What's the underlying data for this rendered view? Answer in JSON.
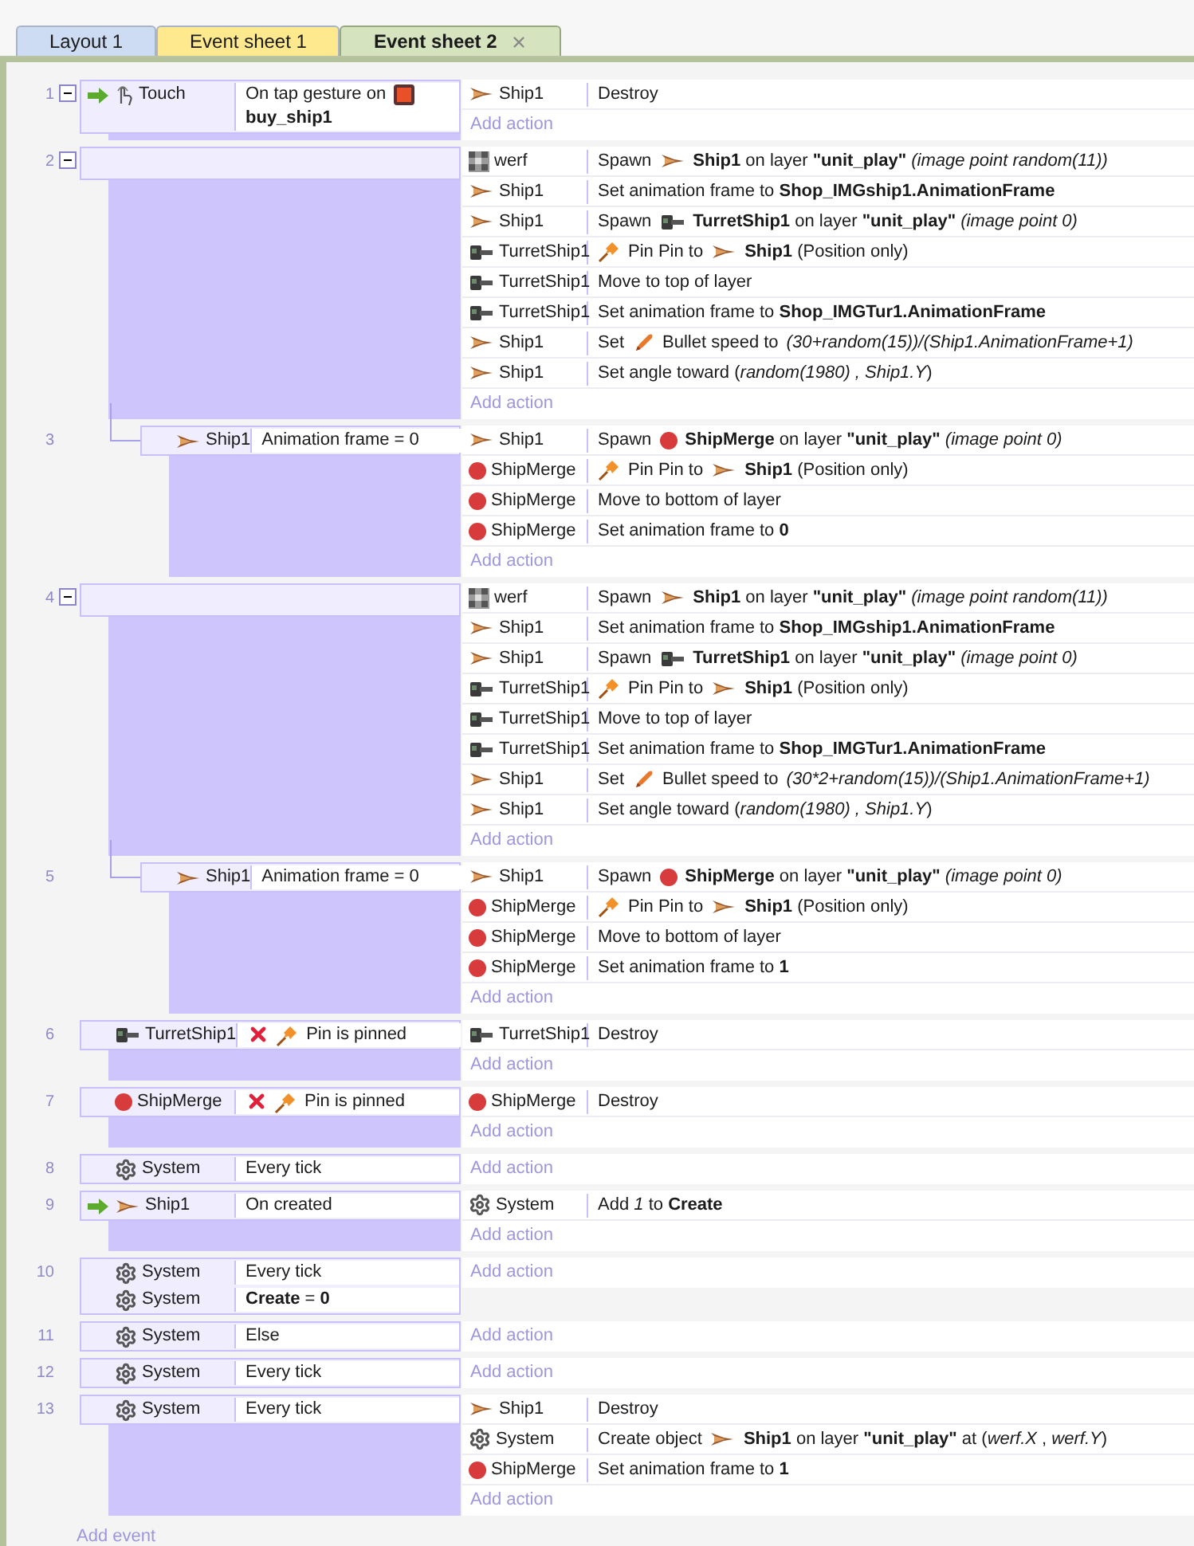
{
  "tabs": [
    {
      "label": "Layout 1",
      "selected": false,
      "color": "#cddcf2"
    },
    {
      "label": "Event sheet 1",
      "selected": false,
      "color": "#ffe98e"
    },
    {
      "label": "Event sheet 2",
      "selected": true,
      "color": "#d6e3bf"
    }
  ],
  "events": [
    {
      "number": "1",
      "expanded": true,
      "conditions": [
        {
          "trigger": true,
          "inverted": false,
          "object": {
            "kind": "touch",
            "name": "Touch"
          },
          "parts": [
            {
              "kind": "text",
              "text": "On tap gesture on"
            },
            {
              "kind": "button"
            },
            {
              "kind": "text",
              "text": "**buy_ship1**"
            }
          ]
        }
      ],
      "actions": [
        {
          "object": {
            "kind": "ship",
            "name": "Ship1"
          },
          "parts": [
            {
              "kind": "text",
              "text": "Destroy"
            }
          ]
        }
      ],
      "add_action": "Add action"
    },
    {
      "number": "2",
      "expanded": true,
      "actions": [
        {
          "object": {
            "kind": "tilemap",
            "name": "werf"
          },
          "parts": [
            {
              "kind": "text",
              "text": "Spawn"
            },
            {
              "kind": "ship"
            },
            {
              "kind": "text",
              "text": "**Ship1** on layer **\"unit_play\"** *(image point random(11))*"
            }
          ]
        },
        {
          "object": {
            "kind": "ship",
            "name": "Ship1"
          },
          "parts": [
            {
              "kind": "text",
              "text": "Set animation frame to **Shop_IMGship1.AnimationFrame**"
            }
          ]
        },
        {
          "object": {
            "kind": "ship",
            "name": "Ship1"
          },
          "parts": [
            {
              "kind": "text",
              "text": "Spawn"
            },
            {
              "kind": "turret"
            },
            {
              "kind": "text",
              "text": "**TurretShip1** on layer **\"unit_play\"** *(image point 0)*"
            }
          ]
        },
        {
          "object": {
            "kind": "turret",
            "name": "TurretShip1"
          },
          "parts": [
            {
              "kind": "pin"
            },
            {
              "kind": "text",
              "text": "Pin Pin to"
            },
            {
              "kind": "ship"
            },
            {
              "kind": "text",
              "text": "**Ship1** (Position only)"
            }
          ]
        },
        {
          "object": {
            "kind": "turret",
            "name": "TurretShip1"
          },
          "parts": [
            {
              "kind": "text",
              "text": "Move to top of layer"
            }
          ]
        },
        {
          "object": {
            "kind": "turret",
            "name": "TurretShip1"
          },
          "parts": [
            {
              "kind": "text",
              "text": "Set animation frame to **Shop_IMGTur1.AnimationFrame**"
            }
          ]
        },
        {
          "object": {
            "kind": "ship",
            "name": "Ship1"
          },
          "parts": [
            {
              "kind": "text",
              "text": "Set"
            },
            {
              "kind": "bullet"
            },
            {
              "kind": "text",
              "text": "Bullet speed to"
            },
            {
              "kind": "expr",
              "text": "(30+random(15))/(Ship1.AnimationFrame+1)"
            }
          ]
        },
        {
          "object": {
            "kind": "ship",
            "name": "Ship1"
          },
          "parts": [
            {
              "kind": "text",
              "text": "Set angle toward (*random(1980) , Ship1.Y*)"
            }
          ]
        }
      ],
      "add_action": "Add action",
      "children": [
        {
          "number": "3",
          "conditions": [
            {
              "trigger": false,
              "inverted": false,
              "object": {
                "kind": "ship",
                "name": "Ship1"
              },
              "parts": [
                {
                  "kind": "text",
                  "text": "Animation frame = 0"
                }
              ]
            }
          ],
          "actions": [
            {
              "object": {
                "kind": "ship",
                "name": "Ship1"
              },
              "parts": [
                {
                  "kind": "text",
                  "text": "Spawn"
                },
                {
                  "kind": "merge"
                },
                {
                  "kind": "text",
                  "text": "**ShipMerge** on layer **\"unit_play\"** *(image point 0)*"
                }
              ]
            },
            {
              "object": {
                "kind": "merge",
                "name": "ShipMerge"
              },
              "parts": [
                {
                  "kind": "pin"
                },
                {
                  "kind": "text",
                  "text": "Pin Pin to"
                },
                {
                  "kind": "ship"
                },
                {
                  "kind": "text",
                  "text": "**Ship1** (Position only)"
                }
              ]
            },
            {
              "object": {
                "kind": "merge",
                "name": "ShipMerge"
              },
              "parts": [
                {
                  "kind": "text",
                  "text": "Move to bottom of layer"
                }
              ]
            },
            {
              "object": {
                "kind": "merge",
                "name": "ShipMerge"
              },
              "parts": [
                {
                  "kind": "text",
                  "text": "Set animation frame to **0**"
                }
              ]
            }
          ],
          "add_action": "Add action"
        }
      ]
    },
    {
      "number": "4",
      "expanded": true,
      "actions": [
        {
          "object": {
            "kind": "tilemap",
            "name": "werf"
          },
          "parts": [
            {
              "kind": "text",
              "text": "Spawn"
            },
            {
              "kind": "ship"
            },
            {
              "kind": "text",
              "text": "**Ship1** on layer **\"unit_play\"** *(image point random(11))*"
            }
          ]
        },
        {
          "object": {
            "kind": "ship",
            "name": "Ship1"
          },
          "parts": [
            {
              "kind": "text",
              "text": "Set animation frame to **Shop_IMGship1.AnimationFrame**"
            }
          ]
        },
        {
          "object": {
            "kind": "ship",
            "name": "Ship1"
          },
          "parts": [
            {
              "kind": "text",
              "text": "Spawn"
            },
            {
              "kind": "turret"
            },
            {
              "kind": "text",
              "text": "**TurretShip1** on layer **\"unit_play\"** *(image point 0)*"
            }
          ]
        },
        {
          "object": {
            "kind": "turret",
            "name": "TurretShip1"
          },
          "parts": [
            {
              "kind": "pin"
            },
            {
              "kind": "text",
              "text": "Pin Pin to"
            },
            {
              "kind": "ship"
            },
            {
              "kind": "text",
              "text": "**Ship1** (Position only)"
            }
          ]
        },
        {
          "object": {
            "kind": "turret",
            "name": "TurretShip1"
          },
          "parts": [
            {
              "kind": "text",
              "text": "Move to top of layer"
            }
          ]
        },
        {
          "object": {
            "kind": "turret",
            "name": "TurretShip1"
          },
          "parts": [
            {
              "kind": "text",
              "text": "Set animation frame to **Shop_IMGTur1.AnimationFrame**"
            }
          ]
        },
        {
          "object": {
            "kind": "ship",
            "name": "Ship1"
          },
          "parts": [
            {
              "kind": "text",
              "text": "Set"
            },
            {
              "kind": "bullet"
            },
            {
              "kind": "text",
              "text": "Bullet speed to"
            },
            {
              "kind": "expr",
              "text": "(30*2+random(15))/(Ship1.AnimationFrame+1)"
            }
          ]
        },
        {
          "object": {
            "kind": "ship",
            "name": "Ship1"
          },
          "parts": [
            {
              "kind": "text",
              "text": "Set angle toward (*random(1980) , Ship1.Y*)"
            }
          ]
        }
      ],
      "add_action": "Add action",
      "children": [
        {
          "number": "5",
          "conditions": [
            {
              "trigger": false,
              "inverted": false,
              "object": {
                "kind": "ship",
                "name": "Ship1"
              },
              "parts": [
                {
                  "kind": "text",
                  "text": "Animation frame = 0"
                }
              ]
            }
          ],
          "actions": [
            {
              "object": {
                "kind": "ship",
                "name": "Ship1"
              },
              "parts": [
                {
                  "kind": "text",
                  "text": "Spawn"
                },
                {
                  "kind": "merge"
                },
                {
                  "kind": "text",
                  "text": "**ShipMerge** on layer **\"unit_play\"** *(image point 0)*"
                }
              ]
            },
            {
              "object": {
                "kind": "merge",
                "name": "ShipMerge"
              },
              "parts": [
                {
                  "kind": "pin"
                },
                {
                  "kind": "text",
                  "text": "Pin Pin to"
                },
                {
                  "kind": "ship"
                },
                {
                  "kind": "text",
                  "text": "**Ship1** (Position only)"
                }
              ]
            },
            {
              "object": {
                "kind": "merge",
                "name": "ShipMerge"
              },
              "parts": [
                {
                  "kind": "text",
                  "text": "Move to bottom of layer"
                }
              ]
            },
            {
              "object": {
                "kind": "merge",
                "name": "ShipMerge"
              },
              "parts": [
                {
                  "kind": "text",
                  "text": "Set animation frame to **1**"
                }
              ]
            }
          ],
          "add_action": "Add action"
        }
      ]
    },
    {
      "number": "6",
      "conditions": [
        {
          "trigger": false,
          "inverted": true,
          "object": {
            "kind": "turret",
            "name": "TurretShip1"
          },
          "parts": [
            {
              "kind": "pin"
            },
            {
              "kind": "text",
              "text": "Pin is pinned"
            }
          ]
        }
      ],
      "actions": [
        {
          "object": {
            "kind": "turret",
            "name": "TurretShip1"
          },
          "parts": [
            {
              "kind": "text",
              "text": "Destroy"
            }
          ]
        }
      ],
      "add_action": "Add action"
    },
    {
      "number": "7",
      "conditions": [
        {
          "trigger": false,
          "inverted": true,
          "object": {
            "kind": "merge",
            "name": "ShipMerge"
          },
          "parts": [
            {
              "kind": "pin"
            },
            {
              "kind": "text",
              "text": "Pin is pinned"
            }
          ]
        }
      ],
      "actions": [
        {
          "object": {
            "kind": "merge",
            "name": "ShipMerge"
          },
          "parts": [
            {
              "kind": "text",
              "text": "Destroy"
            }
          ]
        }
      ],
      "add_action": "Add action"
    },
    {
      "number": "8",
      "conditions": [
        {
          "trigger": false,
          "inverted": false,
          "object": {
            "kind": "system",
            "name": "System"
          },
          "parts": [
            {
              "kind": "text",
              "text": "Every tick"
            }
          ]
        }
      ],
      "add_action": "Add action"
    },
    {
      "number": "9",
      "conditions": [
        {
          "trigger": true,
          "inverted": false,
          "object": {
            "kind": "ship",
            "name": "Ship1"
          },
          "parts": [
            {
              "kind": "text",
              "text": "On created"
            }
          ]
        }
      ],
      "actions": [
        {
          "object": {
            "kind": "system",
            "name": "System"
          },
          "parts": [
            {
              "kind": "text",
              "text": "Add *1* to **Create**"
            }
          ]
        }
      ],
      "add_action": "Add action"
    },
    {
      "number": "10",
      "conditions": [
        {
          "trigger": false,
          "inverted": false,
          "object": {
            "kind": "system",
            "name": "System"
          },
          "parts": [
            {
              "kind": "text",
              "text": "Every tick"
            }
          ]
        },
        {
          "trigger": false,
          "inverted": false,
          "object": {
            "kind": "system",
            "name": "System"
          },
          "parts": [
            {
              "kind": "text",
              "text": "**Create** = **0**"
            }
          ]
        }
      ],
      "add_action": "Add action"
    },
    {
      "number": "11",
      "conditions": [
        {
          "trigger": false,
          "inverted": false,
          "object": {
            "kind": "system",
            "name": "System"
          },
          "parts": [
            {
              "kind": "text",
              "text": "Else"
            }
          ]
        }
      ],
      "add_action": "Add action"
    },
    {
      "number": "12",
      "conditions": [
        {
          "trigger": false,
          "inverted": false,
          "object": {
            "kind": "system",
            "name": "System"
          },
          "parts": [
            {
              "kind": "text",
              "text": "Every tick"
            }
          ]
        }
      ],
      "add_action": "Add action"
    },
    {
      "number": "13",
      "conditions": [
        {
          "trigger": false,
          "inverted": false,
          "object": {
            "kind": "system",
            "name": "System"
          },
          "parts": [
            {
              "kind": "text",
              "text": "Every tick"
            }
          ]
        }
      ],
      "actions": [
        {
          "object": {
            "kind": "ship",
            "name": "Ship1"
          },
          "parts": [
            {
              "kind": "text",
              "text": "Destroy"
            }
          ]
        },
        {
          "object": {
            "kind": "system",
            "name": "System"
          },
          "parts": [
            {
              "kind": "text",
              "text": "Create object"
            },
            {
              "kind": "ship"
            },
            {
              "kind": "text",
              "text": "**Ship1** on layer **\"unit_play\"** at (*werf.X* , *werf.Y*)"
            }
          ]
        },
        {
          "object": {
            "kind": "merge",
            "name": "ShipMerge"
          },
          "parts": [
            {
              "kind": "text",
              "text": "Set animation frame to **1**"
            }
          ]
        }
      ],
      "add_action": "Add action"
    }
  ],
  "add_event": "Add event"
}
